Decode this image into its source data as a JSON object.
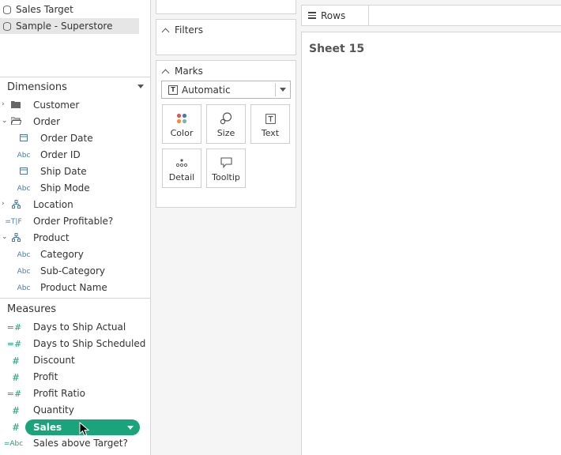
{
  "data_sources": [
    {
      "label": "Sales Target",
      "selected": false
    },
    {
      "label": "Sample - Superstore",
      "selected": true
    }
  ],
  "dimensions": {
    "header": "Dimensions",
    "items": [
      {
        "label": "Customer",
        "icon": "folder-icon",
        "level": 0,
        "expand": "collapsed"
      },
      {
        "label": "Order",
        "icon": "folder-open-icon",
        "level": 0,
        "expand": "expanded"
      },
      {
        "label": "Order Date",
        "icon": "calendar-icon",
        "level": 1
      },
      {
        "label": "Order ID",
        "icon": "abc-icon",
        "level": 1
      },
      {
        "label": "Ship Date",
        "icon": "calendar-icon",
        "level": 1
      },
      {
        "label": "Ship Mode",
        "icon": "abc-icon",
        "level": 1
      },
      {
        "label": "Location",
        "icon": "hierarchy-icon",
        "level": 0,
        "expand": "collapsed"
      },
      {
        "label": "Order Profitable?",
        "icon": "boolean-calc-icon",
        "level": 0
      },
      {
        "label": "Product",
        "icon": "hierarchy-icon",
        "level": 0,
        "expand": "expanded"
      },
      {
        "label": "Category",
        "icon": "abc-icon",
        "level": 1
      },
      {
        "label": "Sub-Category",
        "icon": "abc-icon",
        "level": 1
      },
      {
        "label": "Product Name",
        "icon": "abc-icon",
        "level": 1
      }
    ]
  },
  "measures": {
    "header": "Measures",
    "items": [
      {
        "label": "Days to Ship Actual",
        "icon": "calc-number-icon"
      },
      {
        "label": "Days to Ship Scheduled",
        "icon": "calc-number-icon"
      },
      {
        "label": "Discount",
        "icon": "number-icon"
      },
      {
        "label": "Profit",
        "icon": "number-icon"
      },
      {
        "label": "Profit Ratio",
        "icon": "calc-number-icon"
      },
      {
        "label": "Quantity",
        "icon": "number-icon"
      },
      {
        "label": "Sales",
        "icon": "number-icon",
        "dragging": true
      },
      {
        "label": "Sales above Target?",
        "icon": "calc-abc-icon"
      }
    ]
  },
  "cards": {
    "filters_title": "Filters",
    "marks_title": "Marks",
    "mark_type": "Automatic",
    "mark_buttons": [
      "Color",
      "Size",
      "Text",
      "Detail",
      "Tooltip"
    ]
  },
  "shelves": {
    "rows_label": "Rows"
  },
  "sheet": {
    "title": "Sheet 15"
  },
  "colors": {
    "accent_green": "#1ba37b",
    "dimension_blue": "#4e79a7",
    "measure_green": "#1e9e7a"
  }
}
